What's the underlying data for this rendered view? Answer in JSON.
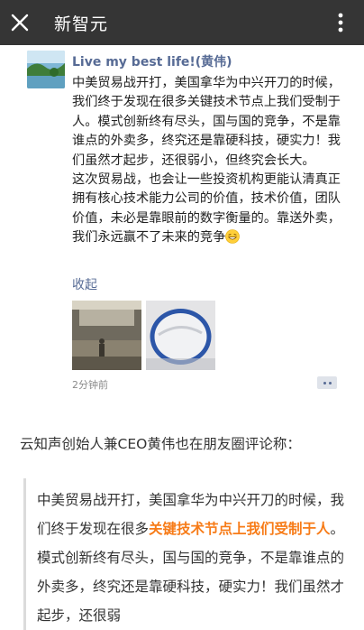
{
  "topbar": {
    "title": "新智元"
  },
  "post": {
    "author": "Live my best life!(黄伟)",
    "text_line_block": "中美贸易战开打，美国拿华为中兴开刀的时候，我们终于发现在很多关键技术节点上我们受制于人。模式创新终有尽头，国与国的竞争，不是靠谁点的外卖多，终究还是靠硬科技，硬实力！我们虽然才起步，还很弱小，但终究会长大。\n这次贸易战，也会让一些投资机构更能认清真正拥有核心技术能力公司的价值，技术价值，团队价值，未必是靠眼前的数字衡量的。靠送外卖，我们永远赢不了未来的竞争",
    "collapse_label": "收起",
    "timestamp": "2分钟前"
  },
  "article": {
    "intro": "云知声创始人兼CEO黄伟也在朋友圈评论称：",
    "quote_part1": "中美贸易战开打，美国拿华为中兴开刀的时候，我们终于发现在很多",
    "quote_highlight": "关键技术节点上我们受制于人",
    "quote_part2": "。模式创新终有尽头，国与国的竞争，不是靠谁点的外卖多，终究还是靠硬科技，硬实力！我们虽然才起步，还很弱"
  },
  "colors": {
    "topbar": "#353535",
    "link": "#576b95",
    "highlight": "#f77b17"
  },
  "icons": {
    "close": "close-icon",
    "more": "more-vertical-icon",
    "emoji": "grin-emoji-icon",
    "comment": "comment-dots-icon"
  }
}
